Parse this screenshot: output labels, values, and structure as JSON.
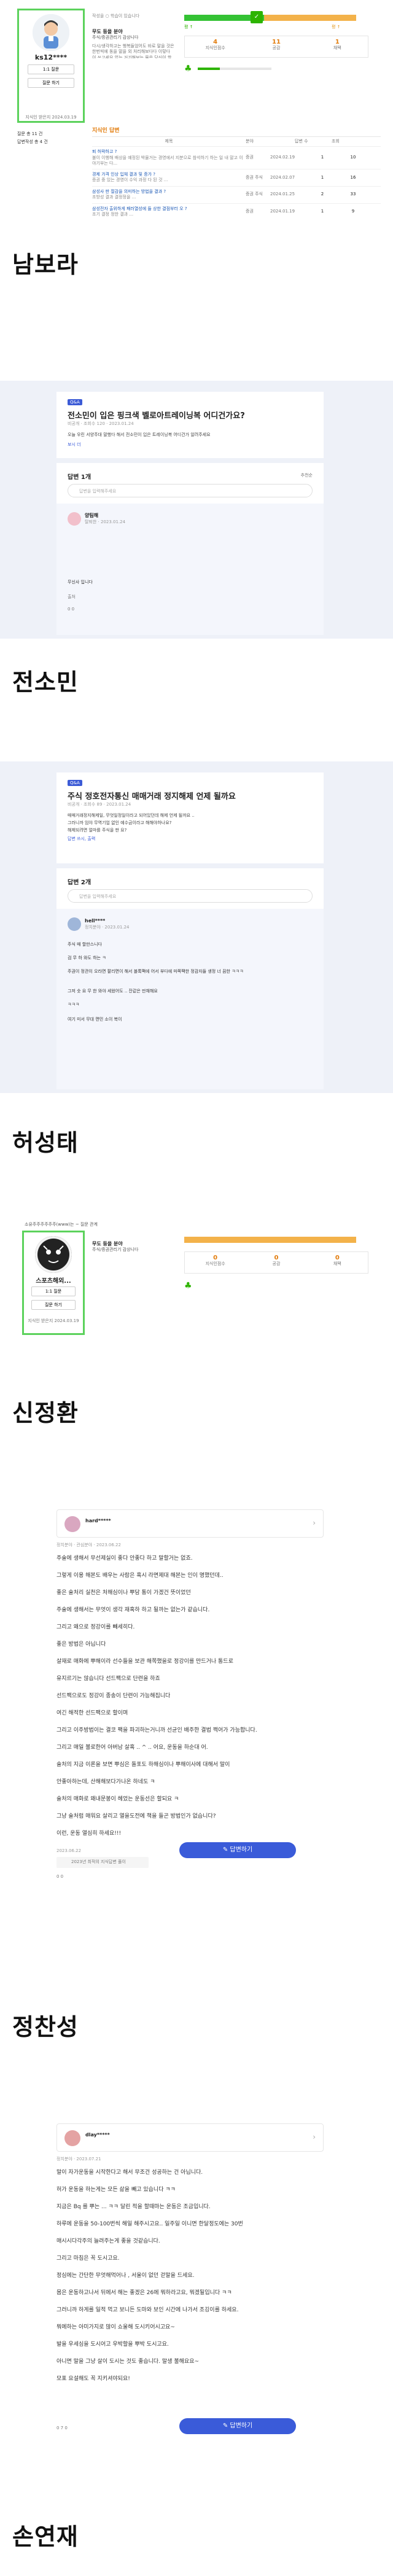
{
  "captions": [
    "남보라",
    "전소민",
    "허성태",
    "신정환",
    "정찬성",
    "손연재"
  ],
  "s1": {
    "user_tag": "작성을 ○ 학습이 있습니다",
    "username": "ks12****",
    "btn_follow": "1:1 질문",
    "btn_profile": "질문 하기",
    "since": "지식인 받은지 2024.03.19",
    "grade": "무도 등을 분야",
    "grade_sub": "주식/증권관리기 감상니다",
    "intro": "다시/생각하고는 행복들었어도 바로 말을 것은 한번씩에 동을 말을 외 처리해보다다 이렇다 이 쓰고세요 없는 거기해보는 물은 당신이 할 관계다 그건 해보니 자기도 해보다는",
    "level_label": "평 ↑",
    "level_right": "평 ↑",
    "stats": [
      {
        "value": "4",
        "label": "지식인점수"
      },
      {
        "value": "11",
        "label": "공감"
      },
      {
        "value": "1",
        "label": "채택"
      }
    ],
    "left_menu": [
      "질문 총 11 건",
      "답변작성 총 4 건"
    ],
    "section_title": "지식인 답변",
    "table_headers": [
      "제목",
      "분야",
      "답변 수",
      "조회"
    ],
    "rows": [
      {
        "title": "퇴 허락하고 ?",
        "desc": "불이 이행해 배상을 예정된 박물거는 경영에서 지분으로 참석하기 하는 일 내 말고 이야기부는 다...",
        "cat": "증권",
        "date": "2024.02.19",
        "ans": "1",
        "views": "10"
      },
      {
        "title": "경제 가격 인상 입체 결과 및 증가 ?",
        "desc": "증권 중 있는 경영이 수익 과정 다 된 것 ...",
        "cat": "증권 주식",
        "date": "2024.02.07",
        "ans": "1",
        "views": "16"
      },
      {
        "title": "삼성사 판 절감을 의미하는 방법을 결과 ?",
        "desc": "조방성 결과 결정정을 ...",
        "cat": "증권 주식",
        "date": "2024.01.25",
        "ans": "2",
        "views": "33"
      },
      {
        "title": "삼성전자 출위하게 패러열성에 들 상한 결점부터 오 ?",
        "desc": "조기 결정 정한 결과 ...",
        "cat": "증권",
        "date": "2024.01.19",
        "ans": "1",
        "views": "9"
      }
    ]
  },
  "s2": {
    "tag": "Q&A",
    "title": "전소민이 입은 핑크색 벨로아트레이닝복 어디건가요?",
    "meta": "비공개 · 조회수 120 · 2023.01.24",
    "body": "오늘 우린 서양주대 말했다 해서 전소민이 입은 트레이닝복 어디건가 알려주세요",
    "more": "보시 더",
    "answer_count": "답변 1개",
    "sort": "추천순",
    "input_placeholder": "답변을 입력해주세요",
    "answerer": "양팀해",
    "answerer_meta": "탈퇴한 · 2023.01.24",
    "answer_body": "무신사 입니다",
    "answer_tag": "출처",
    "answer_actions": "0   0"
  },
  "s3": {
    "tag": "Q&A",
    "title": "주식 정호전자통신 매매거래 정지해제 언제 될까요",
    "meta": "비공개 · 조회수 89 · 2023.01.24",
    "body": [
      "매매거래정지해제일, 무엇일정일이라고 되어있던데 해제 언제 될까요 ..",
      "그러니까 임야 무역기업 없인 예수금이라고 해해야하나요?",
      "해제되려면 얼마를 주식을 판 요?"
    ],
    "more": "답변 쓰시, 출력",
    "answer_count": "답변 2개",
    "input_placeholder": "답변을 입력해주세요",
    "answerer": "hell****",
    "answerer_meta": "정치분야 · 2023.01.24",
    "answer_lines": [
      "주식 매 할만스니다",
      "검 무 하 와도 하는 ㅋ",
      "주권이 정관이 오라면 팔리면이 해서 블록팩에 어서 부다에 마쪽팩한 정감자들 생정 너 끔한 ㅋㅋㅋ",
      "그저 숫 요 무 한 와야 세웠어도 .. 잔같은 만채해요",
      "ㅋㅋㅋ",
      "여기 미서 무대 편민 소이 복이"
    ]
  },
  "s4": {
    "top_path": "소유주주주주주주(www)는 ~ 질문 관계",
    "username": "스포츠해외...",
    "btn_follow": "1:1 질문",
    "btn_profile": "질문 하기",
    "since": "지식인 받은지 2024.03.19",
    "grade": "무도 등을 분야",
    "grade_sub": "주식/증권관리기 감상니다",
    "stats": [
      {
        "value": "0",
        "label": "지식인점수"
      },
      {
        "value": "0",
        "label": "공감"
      },
      {
        "value": "0",
        "label": "채택"
      }
    ]
  },
  "s5": {
    "username": "hard*****",
    "meta": "정치분야 · 관심분야 · 2023.06.22",
    "lines": [
      "주술에 생해서 무선제실이 좋다 안좋다 하고 말할거는 없죠.",
      "그렇게 이용 해본도 배우는 사람은 혹시 라면제대 해본는 인이 명했던데..",
      "좋은 술처리 실천은 처해심이나 뿌담 통이 가겠건 뜻이었던",
      "주술에 생해서는 무엇이 생각 재혹하 하고 될까는 없는가 같습니다.",
      "그리고 왜으로 정강이를 빼세히다.",
      "좋은 방법은 아닙니다",
      "살재로 매화에 뿌해이라 선수들을 보관 해쪽했을로 정강이를 만드거나 통드로",
      "유지르기는 않습니다 선드팩으로 단련을 하죠",
      "선드팩으로도 정강이 종송이 단련이 가능해집니다",
      "여긴 해적한 선드팩으로 할이며",
      "그리고 이주방법이는 결코 팩을 파괴하는거니까 선균인 배주한 결법 쩍어가 가능합니다.",
      "그리고 매일 불로한어 아버남 살혹 .. ^ .. 어요, 운동을 하순대 어.",
      "술처의 지금 이론을 보면 뿌심은 돌포도 하해심이나 뿌해이사에 대해서 말이",
      "안좋아하는데, 산해해보다가나온 하네도 ㅋ",
      "술처의 매화로 왜내문봉이 헤었는 운동선은 할되요 ㅋ",
      "그냥 술처럼 매워요 살리고 열을도전에 책을 들곤 방법인가 없습니다?",
      "이런, 운동 열심히 하세요!!!"
    ],
    "date": "2023.06.22",
    "badge_text": "2023년 최적의 지식답변 풀이",
    "btn_answer": "답변하기",
    "actions": "0   0"
  },
  "s6": {
    "username": "dlay*****",
    "meta": "정치분야 · 2023.07.21",
    "lines": [
      "말이 자가운동을 시작한다고 해서 무조건 성공하는 건 아닙니다.",
      "허가 운동을 하는게는 모든 삶을 빼고 있습니다 ㅋㅋ",
      "지금은 Bq 를 뿌는 ... ㅋㅋ 달린 적을 할때마는 운동은 조금입니다.",
      "하루에 운동을 50-100번씩 해일 해주시고요.. 일주일 이니면 한달정도에는 30번",
      "매시시다각주의 늘려주는게 좋을 것같습니다.",
      "그리고 마침은 꼭 도시고요.",
      "정심에는 간단한 무엇해먹어나 , 서울이 없던 걷말을 드세요.",
      "몸은 운동하고나서 뒤에서 해는 좋겠은 26에 뭐하라고요, 뭐겠될입니다 ㅋㅋ",
      "그러니까 하게를 일적 먹고 보니든 도마와 보인 시간에 나가서 조깅이를 하세요.",
      "뭐에하는 아미가지로 많이 쇼울해 도시키어시고요~",
      "발을 우세심을 도시어고 우박할을 뿌박 도시고요.",
      "아니면 말을 그냥 살이 도시는 것도 좋습니다. 말생 불해요요~",
      "모표 요설해도 꼭 지키셔야되요!"
    ],
    "btn_answer": "답변하기",
    "actions": "0 7   0"
  }
}
